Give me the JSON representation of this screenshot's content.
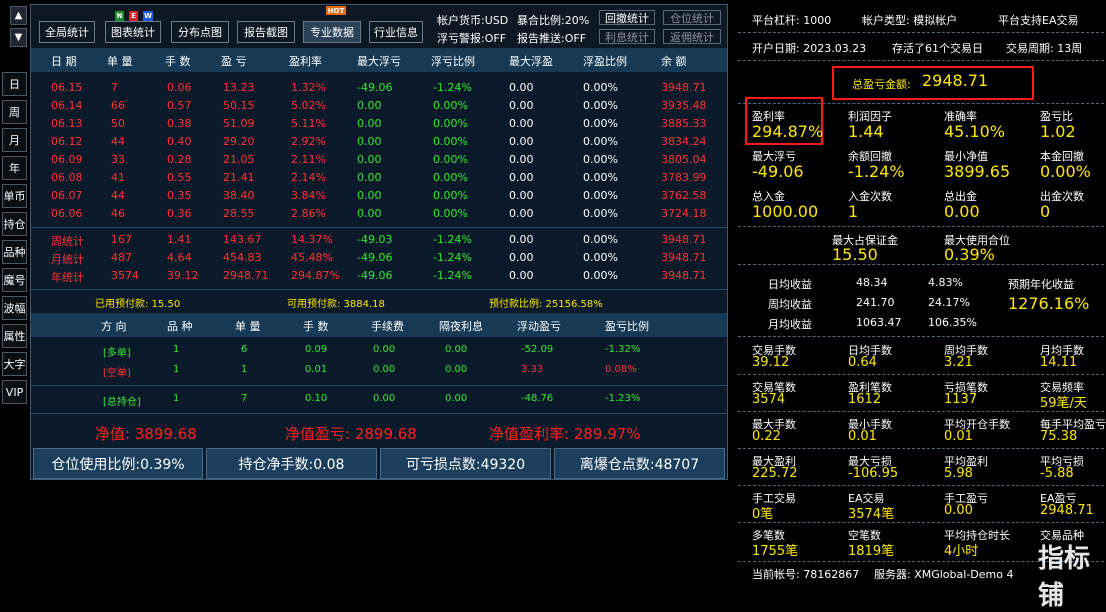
{
  "left_nav": {
    "up": "▲",
    "down": "▼",
    "items": [
      "日",
      "周",
      "月",
      "年",
      "单币",
      "持仓",
      "品种",
      "魔号",
      "波幅",
      "属性",
      "大字",
      "VIP"
    ]
  },
  "toolbar": {
    "buttons": [
      "全局统计",
      "图表统计",
      "分布点图",
      "报告截图",
      "专业数据",
      "行业信息"
    ],
    "new_badge": [
      "N",
      "E",
      "W"
    ],
    "hot_badge": "HOT",
    "currency": "帐户货币:USD",
    "exposure": "暴合比例:20%",
    "float_warn": "浮亏警报:OFF",
    "report_push": "报告推送:OFF",
    "small_btns": [
      "回撤统计",
      "仓位统计",
      "利息统计",
      "返佣统计"
    ]
  },
  "table": {
    "headers": [
      "日 期",
      "单 量",
      "手 数",
      "盈 亏",
      "盈利率",
      "最大浮亏",
      "浮亏比例",
      "最大浮盈",
      "浮盈比例",
      "余 额"
    ],
    "rows": [
      [
        "06.15",
        "7",
        "0.06",
        "13.23",
        "1.32%",
        "-49.06",
        "-1.24%",
        "0.00",
        "0.00%",
        "3948.71"
      ],
      [
        "06.14",
        "66",
        "0.57",
        "50.15",
        "5.02%",
        "0.00",
        "0.00%",
        "0.00",
        "0.00%",
        "3935.48"
      ],
      [
        "06.13",
        "50",
        "0.38",
        "51.09",
        "5.11%",
        "0.00",
        "0.00%",
        "0.00",
        "0.00%",
        "3885.33"
      ],
      [
        "06.12",
        "44",
        "0.40",
        "29.20",
        "2.92%",
        "0.00",
        "0.00%",
        "0.00",
        "0.00%",
        "3834.24"
      ],
      [
        "06.09",
        "33",
        "0.28",
        "21.05",
        "2.11%",
        "0.00",
        "0.00%",
        "0.00",
        "0.00%",
        "3805.04"
      ],
      [
        "06.08",
        "41",
        "0.55",
        "21.41",
        "2.14%",
        "0.00",
        "0.00%",
        "0.00",
        "0.00%",
        "3783.99"
      ],
      [
        "06.07",
        "44",
        "0.35",
        "38.40",
        "3.84%",
        "0.00",
        "0.00%",
        "0.00",
        "0.00%",
        "3762.58"
      ],
      [
        "06.06",
        "46",
        "0.36",
        "28.55",
        "2.86%",
        "0.00",
        "0.00%",
        "0.00",
        "0.00%",
        "3724.18"
      ]
    ],
    "summary": [
      [
        "周统计",
        "167",
        "1.41",
        "143.67",
        "14.37%",
        "-49.03",
        "-1.24%",
        "0.00",
        "0.00%",
        "3948.71"
      ],
      [
        "月统计",
        "487",
        "4.64",
        "454.83",
        "45.48%",
        "-49.06",
        "-1.24%",
        "0.00",
        "0.00%",
        "3948.71"
      ],
      [
        "年统计",
        "3574",
        "39.12",
        "2948.71",
        "294.87%",
        "-49.06",
        "-1.24%",
        "0.00",
        "0.00%",
        "3948.71"
      ]
    ]
  },
  "margin_line": {
    "used": "已用预付款: 15.50",
    "available": "可用预付款: 3884.18",
    "ratio": "预付款比例: 25156.58%"
  },
  "positions": {
    "headers": [
      "方 向",
      "品 种",
      "单 量",
      "手 数",
      "手续费",
      "隔夜利息",
      "浮动盈亏",
      "盈亏比例"
    ],
    "rows": [
      [
        "[多单]",
        "1",
        "6",
        "0.09",
        "0.00",
        "0.00",
        "-52.09",
        "-1.32%"
      ],
      [
        "[空单]",
        "1",
        "1",
        "0.01",
        "0.00",
        "0.00",
        "3.33",
        "0.08%"
      ]
    ],
    "total": [
      "[总持仓]",
      "1",
      "7",
      "0.10",
      "0.00",
      "0.00",
      "-48.76",
      "-1.23%"
    ]
  },
  "equity_line": {
    "net": "净值: 3899.68",
    "net_pl": "净值盈亏: 2899.68",
    "net_rate": "净值盈利率: 289.97%"
  },
  "bottom_bar": [
    "仓位使用比例:0.39%",
    "持仓净手数:0.08",
    "可亏损点数:49320",
    "离爆仓点数:48707"
  ],
  "right": {
    "leverage": "平台杠杆: 1000",
    "account_type": "帐户类型: 模拟帐户",
    "ea_support": "平台支持EA交易",
    "open_date": "开户日期: 2023.03.23",
    "alive": "存活了61个交易日",
    "cycle": "交易周期: 13周",
    "total_pl_label": "总盈亏金额:",
    "total_pl_value": "2948.71",
    "grid1": [
      [
        "盈利率",
        "294.87%"
      ],
      [
        "利润因子",
        "1.44"
      ],
      [
        "准确率",
        "45.10%"
      ],
      [
        "盈亏比",
        "1.02"
      ],
      [
        "最大浮亏",
        "-49.06"
      ],
      [
        "余额回撤",
        "-1.24%"
      ],
      [
        "最小净值",
        "3899.65"
      ],
      [
        "本金回撤",
        "0.00%"
      ],
      [
        "总入金",
        "1000.00"
      ],
      [
        "入金次数",
        "1"
      ],
      [
        "总出金",
        "0.00"
      ],
      [
        "出金次数",
        "0"
      ]
    ],
    "margin_stats": [
      [
        "最大占保证金",
        "15.50"
      ],
      [
        "最大使用合位",
        "0.39%"
      ]
    ],
    "income": [
      [
        "日均收益",
        "48.34",
        "4.83%"
      ],
      [
        "周均收益",
        "241.70",
        "24.17%"
      ],
      [
        "月均收益",
        "1063.47",
        "106.35%"
      ]
    ],
    "annual_label": "预期年化收益",
    "annual_value": "1276.16%",
    "grid2": [
      [
        "交易手数",
        "39.12"
      ],
      [
        "日均手数",
        "0.64"
      ],
      [
        "周均手数",
        "3.21"
      ],
      [
        "月均手数",
        "14.11"
      ],
      [
        "交易笔数",
        "3574"
      ],
      [
        "盈利笔数",
        "1612"
      ],
      [
        "亏损笔数",
        "1137"
      ],
      [
        "交易频率",
        "59笔/天"
      ],
      [
        "最大手数",
        "0.22"
      ],
      [
        "最小手数",
        "0.01"
      ],
      [
        "平均开仓手数",
        "0.01"
      ],
      [
        "每手平均盈亏",
        "75.38"
      ],
      [
        "最大盈利",
        "225.72"
      ],
      [
        "最大亏损",
        "-106.95"
      ],
      [
        "平均盈利",
        "5.98"
      ],
      [
        "平均亏损",
        "-5.88"
      ],
      [
        "手工交易",
        "0笔"
      ],
      [
        "EA交易",
        "3574笔"
      ],
      [
        "手工盈亏",
        "0.00"
      ],
      [
        "EA盈亏",
        "2948.71"
      ],
      [
        "多笔数",
        "1755笔"
      ],
      [
        "空笔数",
        "1819笔"
      ],
      [
        "平均持仓时长",
        "4小时"
      ],
      [
        "交易品种",
        ""
      ]
    ],
    "account_no": "当前帐号: 78162867",
    "server": "服务器: XMGlobal-Demo 4"
  },
  "watermark": "指标铺",
  "colors": {
    "accent_blue": "#163a56",
    "profit_red": "#ff3333",
    "float_green": "#33e833",
    "value_yellow": "#ffe600",
    "highlight_box": "#ff1a1a"
  }
}
